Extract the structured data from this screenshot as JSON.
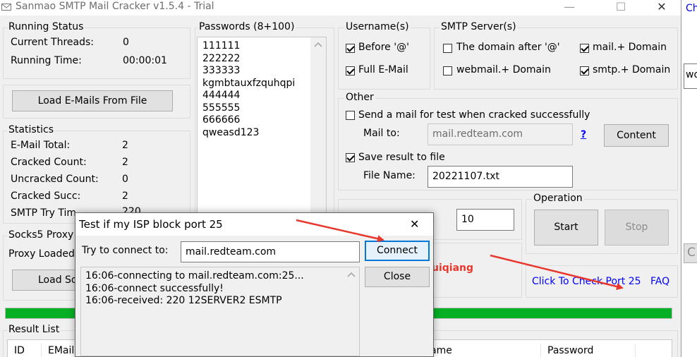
{
  "window": {
    "title": "Sanmao SMTP Mail Cracker v1.5.4 - Trial",
    "minimize_glyph": "—",
    "maximize_glyph": "☐",
    "close_glyph": "✕"
  },
  "running_status": {
    "group_label": "Running Status",
    "threads_label": "Current Threads:",
    "threads_value": "0",
    "time_label": "Running Time:",
    "time_value": "00:00:01"
  },
  "load_emails_label": "Load E-Mails From File",
  "statistics": {
    "group_label": "Statistics",
    "rows": [
      {
        "label": "E-Mail Total:",
        "value": "2"
      },
      {
        "label": "Cracked Count:",
        "value": "2"
      },
      {
        "label": "Uncracked Count:",
        "value": "0"
      },
      {
        "label": "Cracked Succ:",
        "value": "2"
      },
      {
        "label": "SMTP Try Tim",
        "value": "220"
      }
    ]
  },
  "socks": {
    "group_label": "Socks5 Proxy",
    "loaded_label": "Proxy Loaded",
    "load_button": "Load So"
  },
  "passwords": {
    "group_label": "Passwords (8+100)",
    "items": [
      "111111",
      "222222",
      "333333",
      "kgmbtauxfzquhqpi",
      "444444",
      "555555",
      "666666",
      "qweasd123"
    ]
  },
  "username": {
    "group_label": "Username(s)",
    "before_at": "Before '@'",
    "full_email": "Full E-Mail"
  },
  "smtp_servers": {
    "group_label": "SMTP Server(s)",
    "domain_after_at": "The domain after '@'",
    "mail_domain": "mail.+ Domain",
    "webmail_domain": "webmail.+ Domain",
    "smtp_domain": "smtp.+ Domain"
  },
  "other": {
    "group_label": "Other",
    "send_test_label": "Send a mail for test when cracked successfully",
    "mail_to_label": "Mail to:",
    "mail_to_value": "mail.redteam.com",
    "help_link": "?",
    "content_button": "Content",
    "save_result_label": "Save result to file",
    "file_name_label": "File Name:",
    "file_name_value": "20221107.txt"
  },
  "threads": {
    "label_suffix": ":",
    "value": "10"
  },
  "operation": {
    "group_label": "Operation",
    "start_button": "Start",
    "stop_button": "Stop"
  },
  "author_text": "uiqiang",
  "check_port_link": "Click To Check Port 25",
  "faq_link": "FAQ",
  "progress": {
    "fraction": 1.0
  },
  "result_list": {
    "group_label": "Result List",
    "columns": [
      "ID",
      "EMail",
      "ame",
      "Password"
    ]
  },
  "right_strip": {
    "top_text": "Ch",
    "mid_text": "wo",
    "bottom_text": "C"
  },
  "dialog": {
    "title": "Test if my ISP block port 25",
    "close_glyph": "✕",
    "try_label": "Try to connect to:",
    "host_value": "mail.redteam.com",
    "connect_button": "Connect",
    "close_button": "Close",
    "log": [
      "16:06-connecting to mail.redteam.com:25...",
      "16:06-connect successfully!",
      "16:06-received: 220 12SERVER2 ESMTP"
    ]
  },
  "colors": {
    "accent_red": "#e8382e",
    "link_blue": "#0000ff",
    "progress_green": "#06b025"
  }
}
